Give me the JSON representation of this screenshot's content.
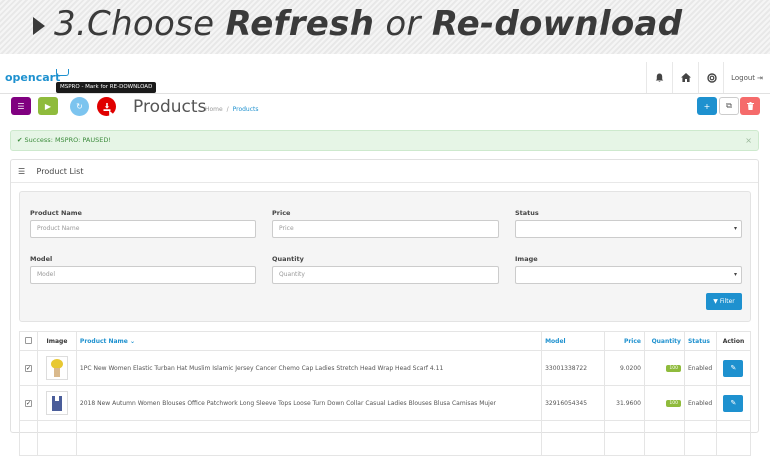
{
  "banner": {
    "step": "3.Choose",
    "word1": "Refresh",
    "or": "or",
    "word2": "Re-download"
  },
  "navbar": {
    "logo": "opencart",
    "logout_label": "Logout"
  },
  "tooltip": "MSPRO - Mark for RE-DOWNLOAD",
  "header": {
    "title": "Products",
    "breadcrumb": [
      "Home",
      "Products"
    ],
    "breadcrumb_sep": "/"
  },
  "alert": {
    "text": "Success: MSPRO: PAUSED!",
    "close": "×"
  },
  "panel": {
    "title": "Product List"
  },
  "filter": {
    "product_name_label": "Product Name",
    "product_name_placeholder": "Product Name",
    "price_label": "Price",
    "price_placeholder": "Price",
    "status_label": "Status",
    "status_value": "",
    "model_label": "Model",
    "model_placeholder": "Model",
    "quantity_label": "Quantity",
    "quantity_placeholder": "Quantity",
    "image_label": "Image",
    "image_value": "",
    "filter_button": "Filter"
  },
  "table": {
    "headers": {
      "image": "Image",
      "product_name": "Product Name",
      "model": "Model",
      "price": "Price",
      "quantity": "Quantity",
      "status": "Status",
      "action": "Action"
    },
    "rows": [
      {
        "checked": true,
        "name": "1PC New Women Elastic Turban Hat Muslim Islamic Jersey Cancer Chemo Cap Ladies Stretch Head Wrap Head Scarf 4.11",
        "model": "33001338722",
        "price": "9.0200",
        "quantity": "100",
        "status": "Enabled"
      },
      {
        "checked": true,
        "name": "2018 New Autumn Women Blouses Office Patchwork Long Sleeve Tops Loose Turn Down Collar Casual Ladies Blouses Blusa Camisas Mujer",
        "model": "32916054345",
        "price": "31.9600",
        "quantity": "100",
        "status": "Enabled"
      }
    ]
  },
  "colors": {
    "primary": "#1e91cf",
    "purple": "#800080",
    "green": "#8fbb3c",
    "red": "#e00000",
    "light_blue": "#7cc4ef",
    "danger": "#f56b6b"
  }
}
